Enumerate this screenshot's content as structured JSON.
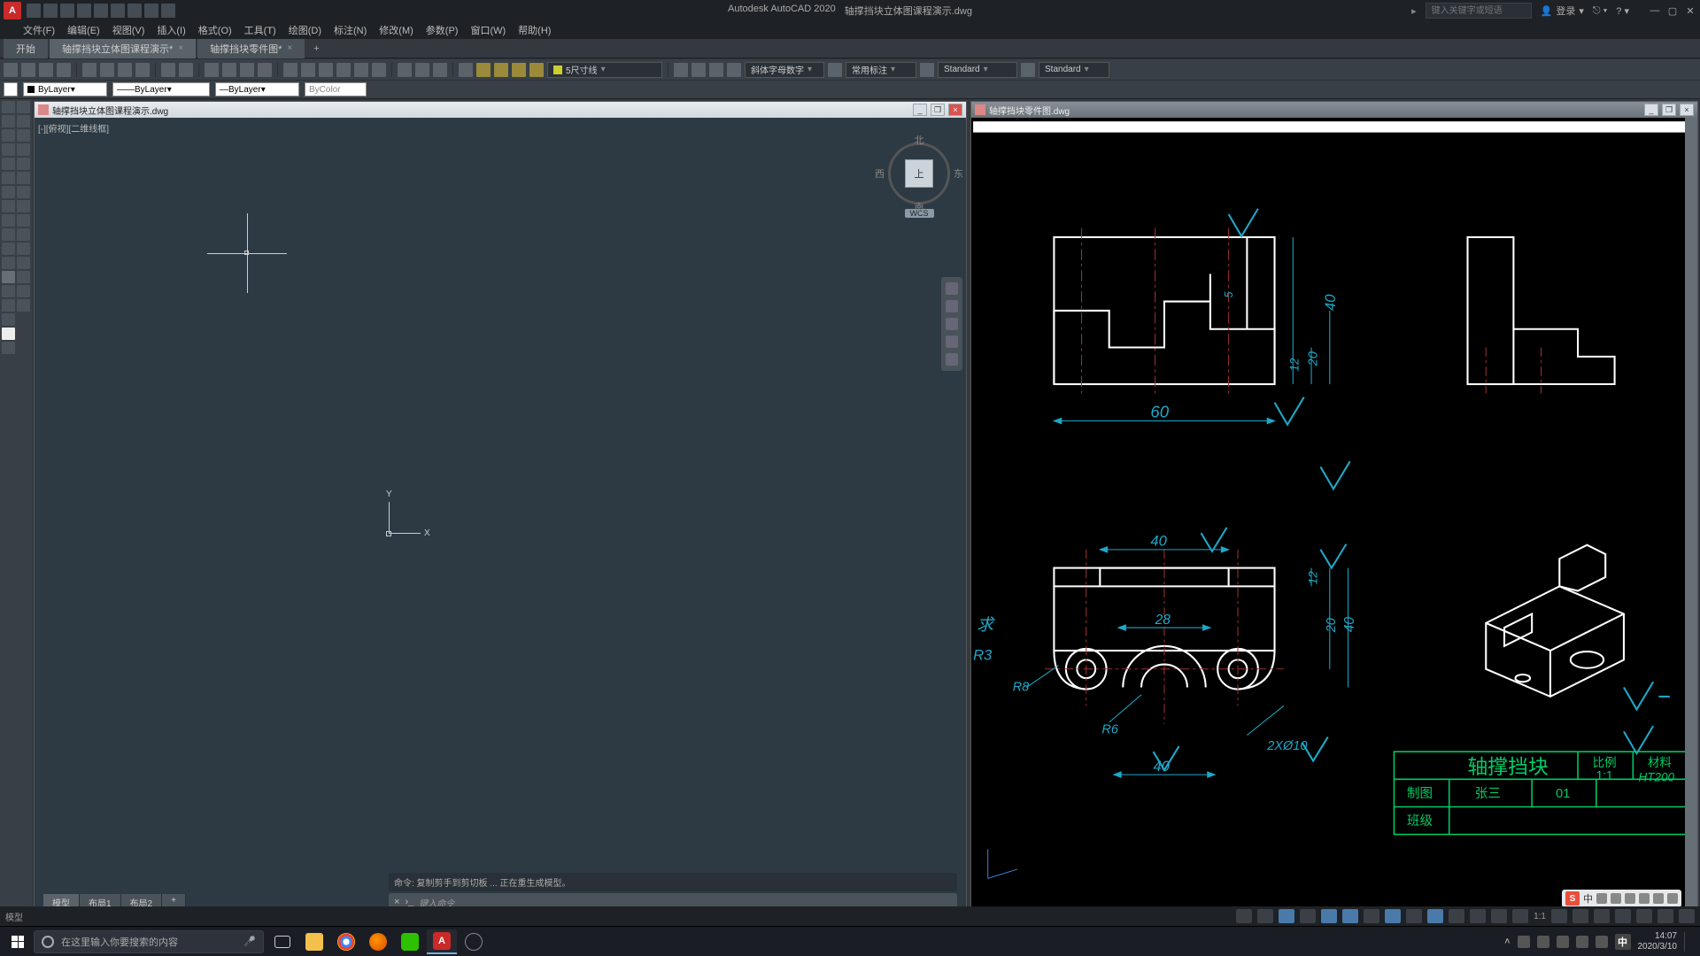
{
  "title": {
    "app": "Autodesk AutoCAD 2020",
    "file": "轴撑挡块立体图课程演示.dwg"
  },
  "titlebar": {
    "search_placeholder": "键入关键字或短语",
    "login": "登录"
  },
  "menubar": [
    "文件(F)",
    "编辑(E)",
    "视图(V)",
    "插入(I)",
    "格式(O)",
    "工具(T)",
    "绘图(D)",
    "标注(N)",
    "修改(M)",
    "参数(P)",
    "窗口(W)",
    "帮助(H)"
  ],
  "filetabs": {
    "items": [
      "开始",
      "轴撑挡块立体图课程演示*",
      "轴撑挡块零件图*"
    ]
  },
  "toolbar": {
    "dim_style_box": "5尺寸线",
    "text_style_a": "斜体字母数字",
    "text_style_b": "常用标注",
    "std1": "Standard",
    "std2": "Standard"
  },
  "layerbar": {
    "layer": "ByLayer",
    "linetype": "ByLayer",
    "lineweight": "ByLayer",
    "color": "ByColor"
  },
  "leftwin": {
    "title": "轴撑挡块立体图课程演示.dwg",
    "viewlabel": "[-][俯视][二维线框]",
    "viewcube": {
      "n": "北",
      "s": "南",
      "w": "西",
      "e": "东",
      "face": "上",
      "wcs": "WCS"
    },
    "ucs": {
      "x": "X",
      "y": "Y"
    }
  },
  "rightwin": {
    "title": "轴撑挡块零件图.dwg",
    "dims": {
      "d60": "60",
      "d40a": "40",
      "d20a": "20",
      "d12a": "12",
      "d5": "5",
      "d40b": "40",
      "d28": "28",
      "d40c": "40",
      "r8": "R8",
      "r6": "R6",
      "d2x": "2XØ10",
      "d12b": "12",
      "d20b": "20",
      "d40d": "40",
      "r3": "R3",
      "qiu": "求"
    },
    "titleblock": {
      "name": "轴撑挡块",
      "scale_l": "比例",
      "scale_v": "1:1",
      "mat_l": "材料",
      "mat_v": "HT200",
      "draw_l": "制图",
      "draw_name": "张三",
      "draw_no": "01",
      "class_l": "班级"
    }
  },
  "cmd": {
    "hist": "命令: 复制剪手到剪切板 ... 正在重生成模型。",
    "placeholder": "键入命令"
  },
  "bottomtabs": [
    "模型",
    "布局1",
    "布局2",
    "+"
  ],
  "statusbar": {
    "left": "模型",
    "scale": "1:1"
  },
  "taskbar": {
    "search": "在这里输入你要搜索的内容",
    "ime": "S",
    "ime2": "中",
    "time": "14:07",
    "date": "2020/3/10"
  }
}
